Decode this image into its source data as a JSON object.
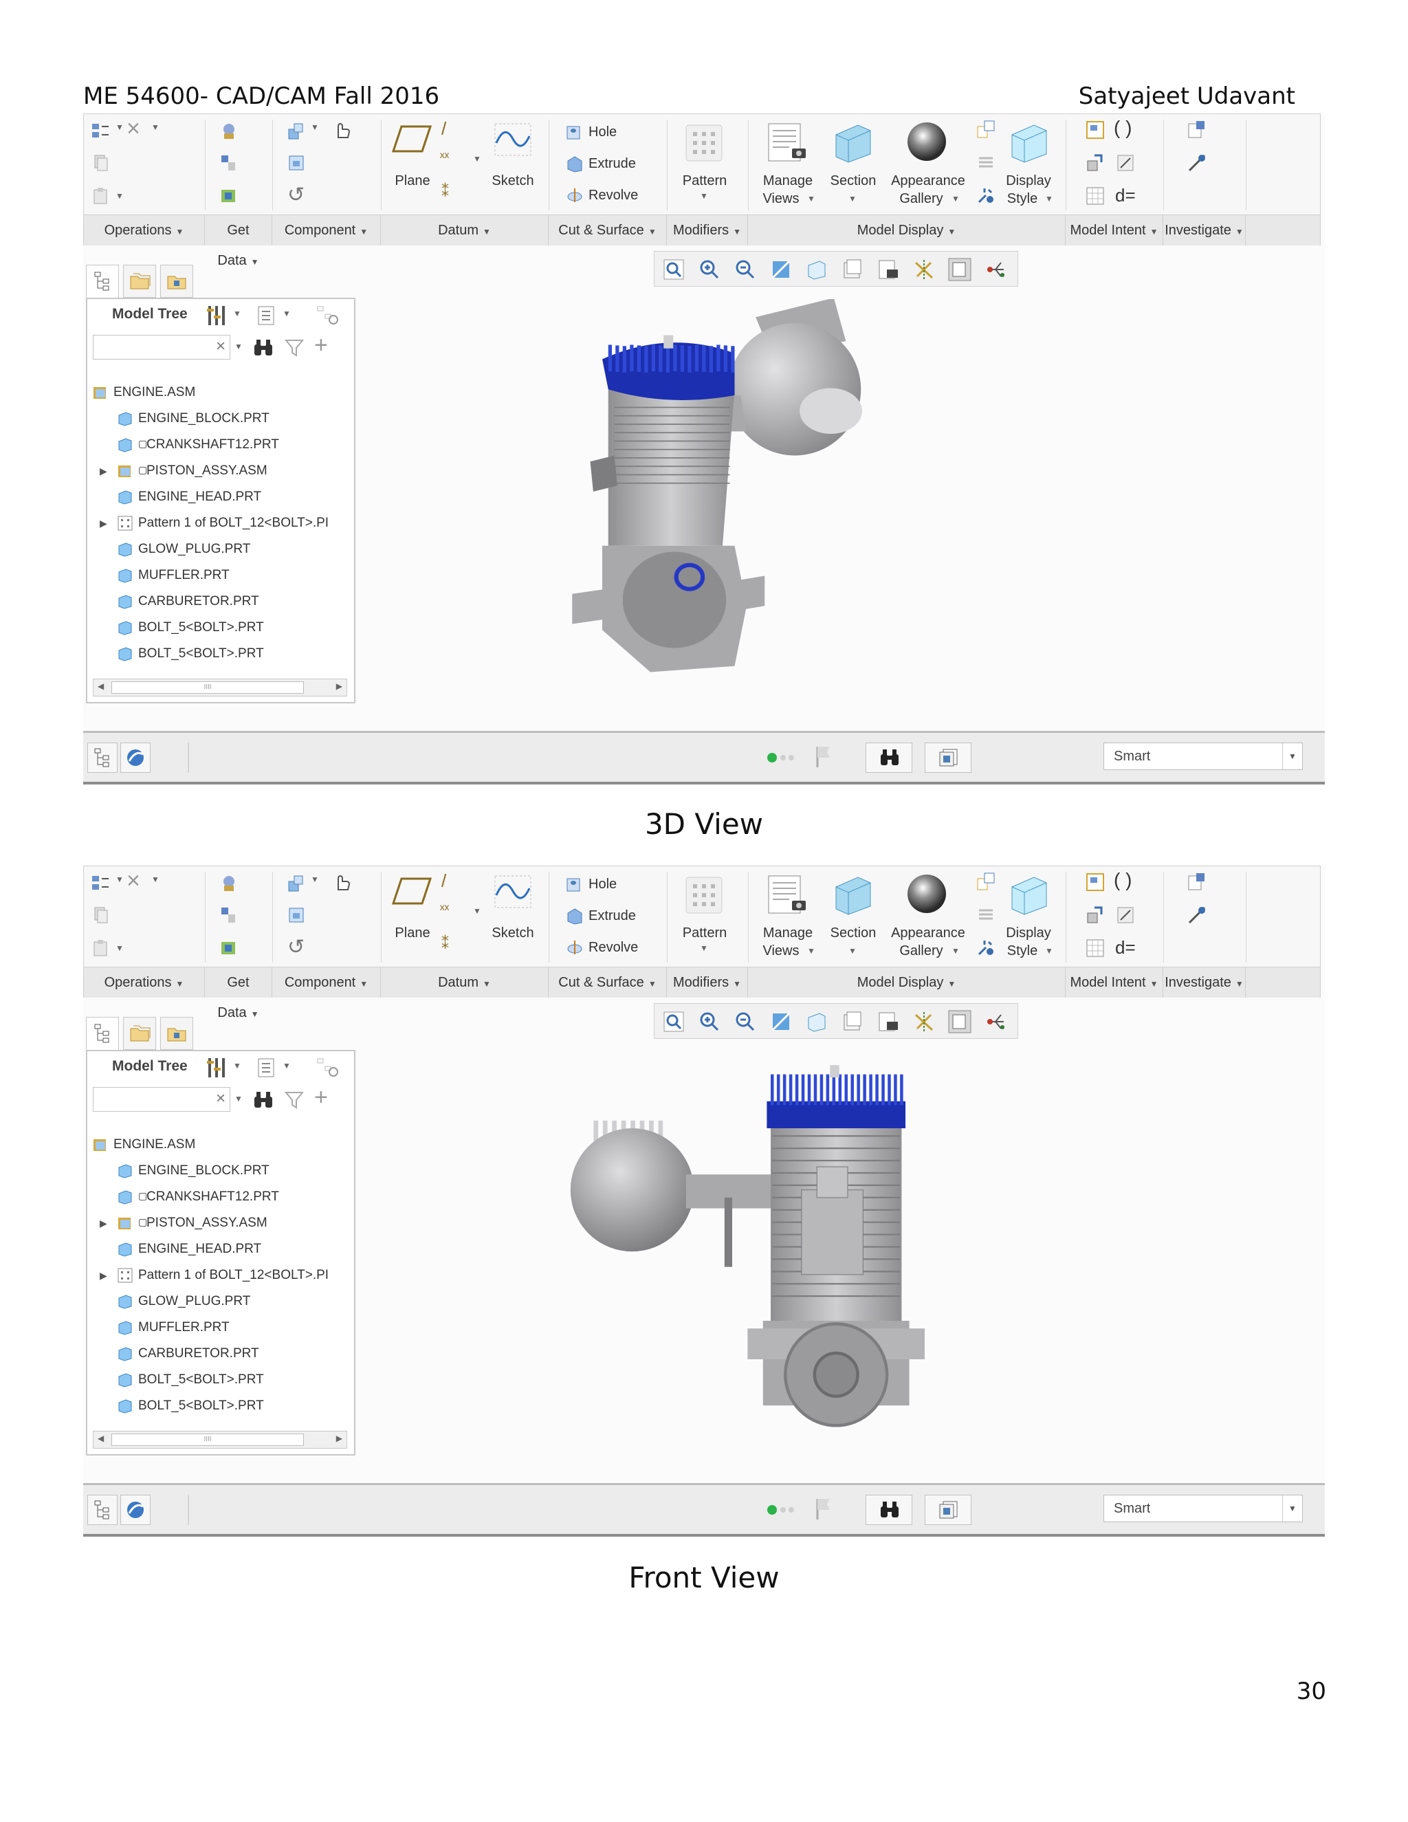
{
  "header": {
    "left": "ME 54600- CAD/CAM Fall 2016",
    "right": "Satyajeet Udavant"
  },
  "page_number": "30",
  "screens": [
    {
      "caption": "3D View",
      "ribbon": {
        "buttons": {
          "plane": "Plane",
          "sketch": "Sketch",
          "hole": "Hole",
          "extrude": "Extrude",
          "revolve": "Revolve",
          "pattern": "Pattern",
          "manage_views_1": "Manage",
          "manage_views_2": "Views",
          "section": "Section",
          "appearance_1": "Appearance",
          "appearance_2": "Gallery",
          "display_1": "Display",
          "display_2": "Style",
          "deq": "d="
        },
        "groups": [
          "Operations",
          "Get Data",
          "Component",
          "Datum",
          "Cut & Surface",
          "Modifiers",
          "Model Display",
          "Model Intent",
          "Investigate"
        ]
      },
      "tree": {
        "title": "Model Tree",
        "items": [
          {
            "label": "ENGINE.ASM"
          },
          {
            "label": "ENGINE_BLOCK.PRT"
          },
          {
            "label": "CRANKSHAFT12.PRT"
          },
          {
            "label": "PISTON_ASSY.ASM"
          },
          {
            "label": "ENGINE_HEAD.PRT"
          },
          {
            "label": "Pattern 1 of BOLT_12<BOLT>.PI"
          },
          {
            "label": "GLOW_PLUG.PRT"
          },
          {
            "label": "MUFFLER.PRT"
          },
          {
            "label": "CARBURETOR.PRT"
          },
          {
            "label": "BOLT_5<BOLT>.PRT"
          },
          {
            "label": "BOLT_5<BOLT>.PRT"
          }
        ]
      },
      "status": {
        "smart": "Smart"
      }
    },
    {
      "caption": "Front View",
      "ribbon": {
        "buttons": {
          "plane": "Plane",
          "sketch": "Sketch",
          "hole": "Hole",
          "extrude": "Extrude",
          "revolve": "Revolve",
          "pattern": "Pattern",
          "manage_views_1": "Manage",
          "manage_views_2": "Views",
          "section": "Section",
          "appearance_1": "Appearance",
          "appearance_2": "Gallery",
          "display_1": "Display",
          "display_2": "Style",
          "deq": "d="
        },
        "groups": [
          "Operations",
          "Get Data",
          "Component",
          "Datum",
          "Cut & Surface",
          "Modifiers",
          "Model Display",
          "Model Intent",
          "Investigate"
        ]
      },
      "tree": {
        "title": "Model Tree",
        "items": [
          {
            "label": "ENGINE.ASM"
          },
          {
            "label": "ENGINE_BLOCK.PRT"
          },
          {
            "label": "CRANKSHAFT12.PRT"
          },
          {
            "label": "PISTON_ASSY.ASM"
          },
          {
            "label": "ENGINE_HEAD.PRT"
          },
          {
            "label": "Pattern 1 of BOLT_12<BOLT>.PI"
          },
          {
            "label": "GLOW_PLUG.PRT"
          },
          {
            "label": "MUFFLER.PRT"
          },
          {
            "label": "CARBURETOR.PRT"
          },
          {
            "label": "BOLT_5<BOLT>.PRT"
          },
          {
            "label": "BOLT_5<BOLT>.PRT"
          }
        ]
      },
      "status": {
        "smart": "Smart"
      }
    }
  ],
  "colors": {
    "engine_head": "#1c2fb0",
    "engine_body": "#a9a9ac",
    "ribbon_bg": "#f7f7f7",
    "status_led": "#2cb34a"
  }
}
